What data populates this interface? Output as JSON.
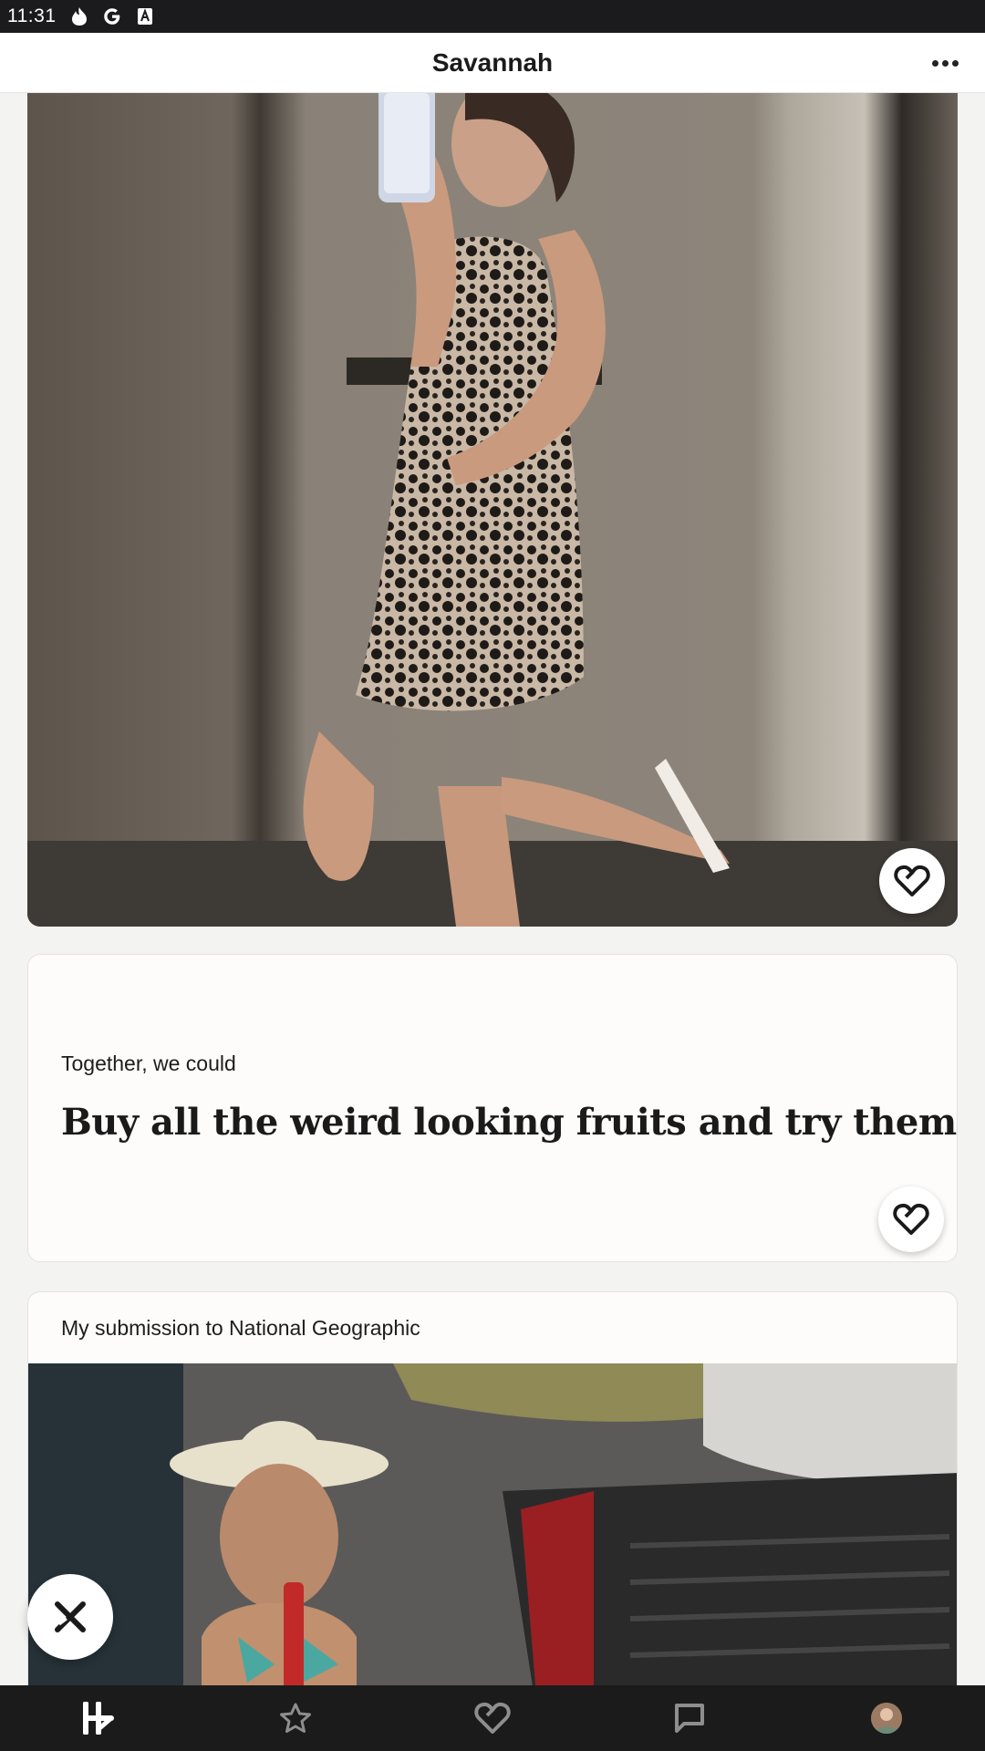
{
  "status_bar": {
    "time": "11:31",
    "icons": [
      "flame-icon",
      "google-icon",
      "keyboard-a-icon"
    ]
  },
  "header": {
    "title": "Savannah",
    "more_icon": "more-horizontal-icon"
  },
  "feed": {
    "photo_1": {
      "description_icon": "photo",
      "like_icon": "heart-outline-icon"
    },
    "prompt": {
      "question": "Together, we could",
      "answer": "Buy all the weird looking fruits and try them",
      "like_icon": "heart-outline-icon"
    },
    "photo_2": {
      "caption": "My submission to National Geographic"
    }
  },
  "reject_icon": "x-cross-icon",
  "bottom_nav": {
    "items": [
      "home-logo-icon",
      "star-icon",
      "heart-icon",
      "chat-icon",
      "profile-avatar"
    ]
  },
  "colors": {
    "status_bar_bg": "#1b1b1d",
    "nav_bg": "#1b1b1b",
    "card_bg": "#fdfcfb",
    "page_bg": "#f3f3f2"
  }
}
